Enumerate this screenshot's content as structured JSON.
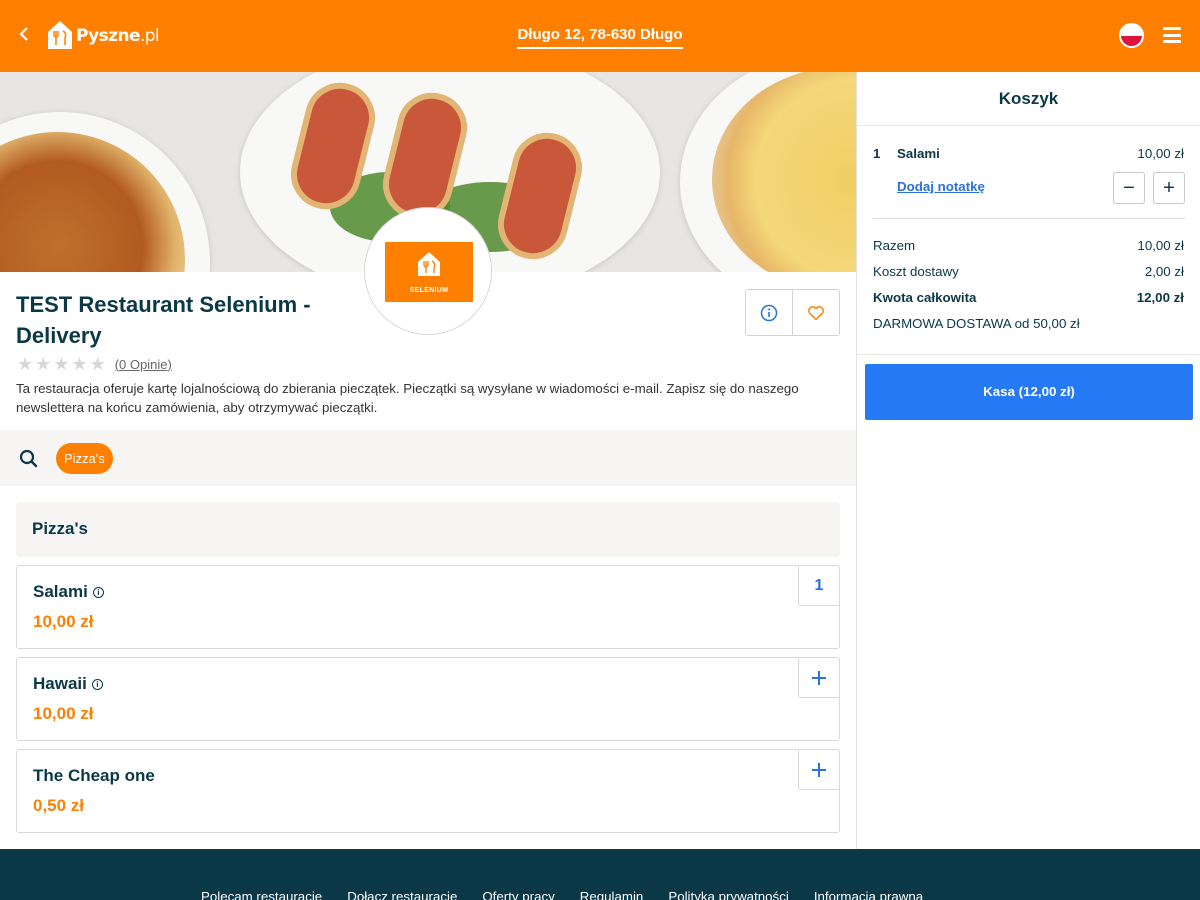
{
  "header": {
    "logo_main": "Pyszne",
    "logo_suffix": ".pl",
    "address": "Długo 12, 78-630 Długo"
  },
  "restaurant": {
    "name": "TEST Restaurant Selenium - Delivery",
    "logo_label": "SELENIUM",
    "rating_stars": 0,
    "reviews": "(0 Opinie)",
    "description": "Ta restauracja oferuje kartę lojalnościową do zbierania pieczątek. Pieczątki są wysyłane w wiadomości e-mail. Zapisz się do naszego newslettera na końcu zamówienia, aby otrzymywać pieczątki."
  },
  "categories": {
    "chip": "Pizza's"
  },
  "menu": {
    "section_title": "Pizza's",
    "items": [
      {
        "name": "Salami",
        "price": "10,00 zł",
        "action": "1",
        "has_info": true
      },
      {
        "name": "Hawaii",
        "price": "10,00 zł",
        "action": "+",
        "has_info": true
      },
      {
        "name": "The Cheap one",
        "price": "0,50 zł",
        "action": "+",
        "has_info": false
      }
    ]
  },
  "basket": {
    "title": "Koszyk",
    "line": {
      "qty": "1",
      "name": "Salami",
      "price": "10,00 zł"
    },
    "add_note": "Dodaj notatkę",
    "minus": "−",
    "plus": "+",
    "subtotal_label": "Razem",
    "subtotal_value": "10,00 zł",
    "delivery_label": "Koszt dostawy",
    "delivery_value": "2,00 zł",
    "total_label": "Kwota całkowita",
    "total_value": "12,00 zł",
    "free_delivery": "DARMOWA DOSTAWA od 50,00 zł",
    "checkout": "Kasa (12,00 zł)"
  },
  "footer": {
    "links": [
      "Polecam restaurację",
      "Dołącz restaurację",
      "Oferty pracy",
      "Regulamin",
      "Polityka prywatności",
      "Informacja prawna"
    ]
  },
  "colors": {
    "brand": "#ff8000",
    "accent_blue": "#2579f5",
    "text_dark": "#0a3847",
    "footer_bg": "#0a3847"
  }
}
